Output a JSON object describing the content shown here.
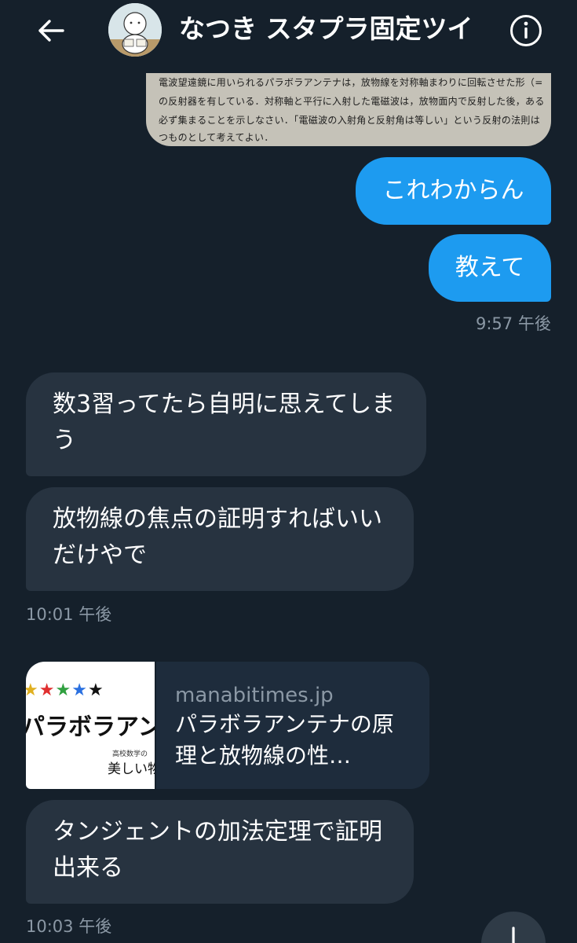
{
  "header": {
    "title": "なつき スタプラ固定ツイ"
  },
  "photo_text": [
    "電波望遠鏡に用いられるパラボラアンテナは，放物線を対称軸まわりに回転させた形（=",
    "の反射器を有している．対称軸と平行に入射した電磁波は，放物面内で反射した後，ある",
    "必ず集まることを示しなさい．「電磁波の入射角と反射角は等しい」という反射の法則は",
    "つものとして考えてよい．"
  ],
  "messages": {
    "m1": "これわからん",
    "m2": "教えて",
    "t1": "9:57 午後",
    "m3": "数3習ってたら自明に思えてしまう",
    "m4": "放物線の焦点の証明すればいいだけやで",
    "t2": "10:01 午後",
    "m5": "タンジェントの加法定理で証明出来る",
    "t3": "10:03 午後"
  },
  "link_card": {
    "domain": "manabitimes.jp",
    "title": "パラボラアンテナの原理と放物線の性…",
    "thumb_title": "パラボラアンテナ",
    "thumb_small": "高校数学の",
    "thumb_bold": "美しい物"
  }
}
